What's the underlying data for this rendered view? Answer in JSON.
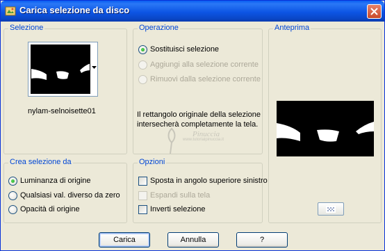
{
  "window": {
    "title": "Carica selezione da disco",
    "close_label": "✕"
  },
  "selezione": {
    "legend": "Selezione",
    "selected_file": "nylam-selnoisette01"
  },
  "operazione": {
    "legend": "Operazione",
    "options": [
      {
        "label": "Sostituisci selezione",
        "selected": true,
        "enabled": true
      },
      {
        "label": "Aggiungi alla selezione corrente",
        "selected": false,
        "enabled": false
      },
      {
        "label": "Rimuovi dalla selezione corrente",
        "selected": false,
        "enabled": false
      }
    ],
    "info": "Il rettangolo originale della selezione intersecherà completamente la tela."
  },
  "anteprima": {
    "legend": "Anteprima"
  },
  "crea": {
    "legend": "Crea selezione da",
    "options": [
      {
        "label": "Luminanza di origine",
        "selected": true
      },
      {
        "label": "Qualsiasi val. diverso da zero",
        "selected": false
      },
      {
        "label": "Opacità di origine",
        "selected": false
      }
    ]
  },
  "opzioni": {
    "legend": "Opzioni",
    "items": [
      {
        "label": "Sposta in angolo superiore sinistro",
        "checked": false,
        "enabled": true
      },
      {
        "label": "Espandi sulla tela",
        "checked": false,
        "enabled": false
      },
      {
        "label": "Inverti selezione",
        "checked": false,
        "enabled": true
      }
    ]
  },
  "watermark": {
    "line1": "Pinuccia",
    "line2": "www.tutorialpinuccia.it"
  },
  "buttons": {
    "carica": "Carica",
    "annulla": "Annulla",
    "help": "?"
  }
}
